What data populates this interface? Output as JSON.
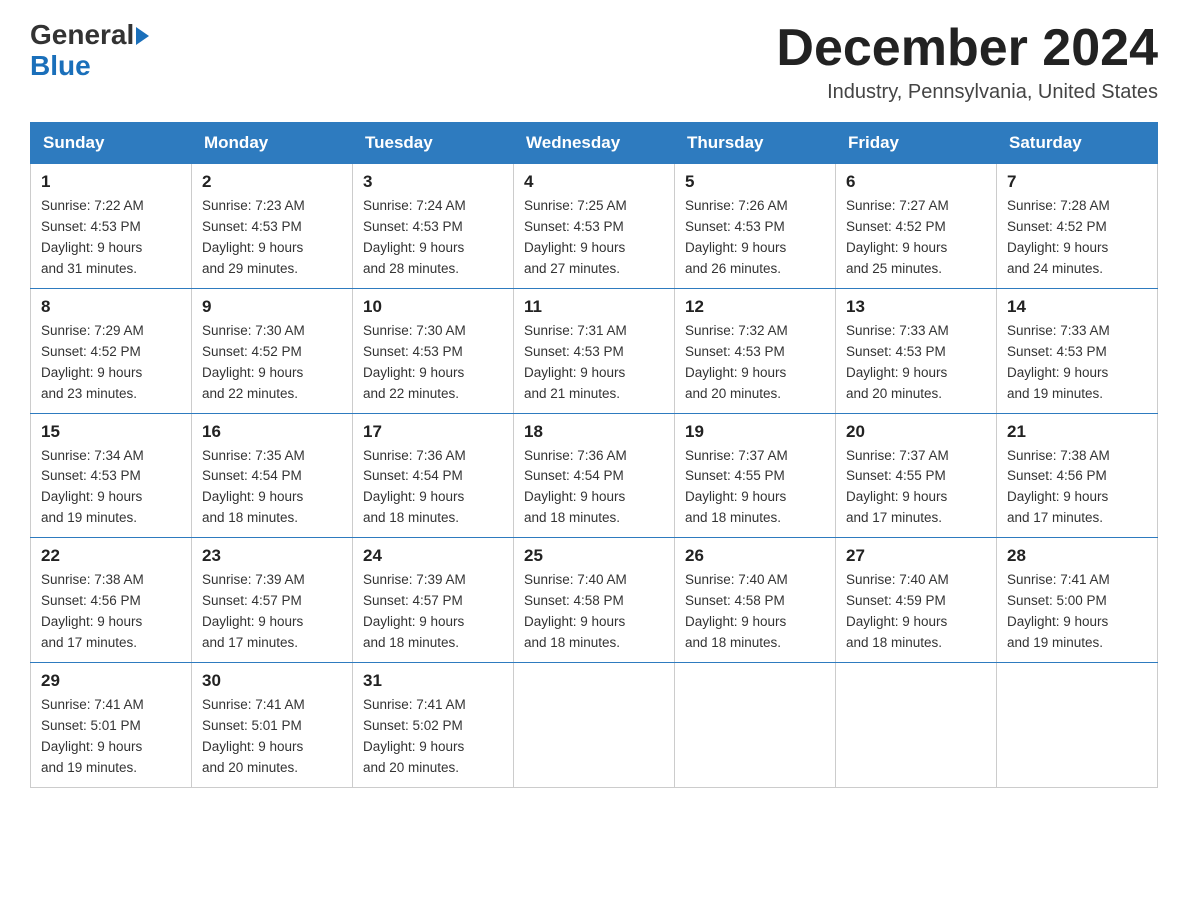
{
  "header": {
    "logo_general": "General",
    "logo_blue": "Blue",
    "title": "December 2024",
    "location": "Industry, Pennsylvania, United States"
  },
  "days_of_week": [
    "Sunday",
    "Monday",
    "Tuesday",
    "Wednesday",
    "Thursday",
    "Friday",
    "Saturday"
  ],
  "weeks": [
    [
      {
        "day": "1",
        "sunrise": "7:22 AM",
        "sunset": "4:53 PM",
        "daylight": "9 hours and 31 minutes."
      },
      {
        "day": "2",
        "sunrise": "7:23 AM",
        "sunset": "4:53 PM",
        "daylight": "9 hours and 29 minutes."
      },
      {
        "day": "3",
        "sunrise": "7:24 AM",
        "sunset": "4:53 PM",
        "daylight": "9 hours and 28 minutes."
      },
      {
        "day": "4",
        "sunrise": "7:25 AM",
        "sunset": "4:53 PM",
        "daylight": "9 hours and 27 minutes."
      },
      {
        "day": "5",
        "sunrise": "7:26 AM",
        "sunset": "4:53 PM",
        "daylight": "9 hours and 26 minutes."
      },
      {
        "day": "6",
        "sunrise": "7:27 AM",
        "sunset": "4:52 PM",
        "daylight": "9 hours and 25 minutes."
      },
      {
        "day": "7",
        "sunrise": "7:28 AM",
        "sunset": "4:52 PM",
        "daylight": "9 hours and 24 minutes."
      }
    ],
    [
      {
        "day": "8",
        "sunrise": "7:29 AM",
        "sunset": "4:52 PM",
        "daylight": "9 hours and 23 minutes."
      },
      {
        "day": "9",
        "sunrise": "7:30 AM",
        "sunset": "4:52 PM",
        "daylight": "9 hours and 22 minutes."
      },
      {
        "day": "10",
        "sunrise": "7:30 AM",
        "sunset": "4:53 PM",
        "daylight": "9 hours and 22 minutes."
      },
      {
        "day": "11",
        "sunrise": "7:31 AM",
        "sunset": "4:53 PM",
        "daylight": "9 hours and 21 minutes."
      },
      {
        "day": "12",
        "sunrise": "7:32 AM",
        "sunset": "4:53 PM",
        "daylight": "9 hours and 20 minutes."
      },
      {
        "day": "13",
        "sunrise": "7:33 AM",
        "sunset": "4:53 PM",
        "daylight": "9 hours and 20 minutes."
      },
      {
        "day": "14",
        "sunrise": "7:33 AM",
        "sunset": "4:53 PM",
        "daylight": "9 hours and 19 minutes."
      }
    ],
    [
      {
        "day": "15",
        "sunrise": "7:34 AM",
        "sunset": "4:53 PM",
        "daylight": "9 hours and 19 minutes."
      },
      {
        "day": "16",
        "sunrise": "7:35 AM",
        "sunset": "4:54 PM",
        "daylight": "9 hours and 18 minutes."
      },
      {
        "day": "17",
        "sunrise": "7:36 AM",
        "sunset": "4:54 PM",
        "daylight": "9 hours and 18 minutes."
      },
      {
        "day": "18",
        "sunrise": "7:36 AM",
        "sunset": "4:54 PM",
        "daylight": "9 hours and 18 minutes."
      },
      {
        "day": "19",
        "sunrise": "7:37 AM",
        "sunset": "4:55 PM",
        "daylight": "9 hours and 18 minutes."
      },
      {
        "day": "20",
        "sunrise": "7:37 AM",
        "sunset": "4:55 PM",
        "daylight": "9 hours and 17 minutes."
      },
      {
        "day": "21",
        "sunrise": "7:38 AM",
        "sunset": "4:56 PM",
        "daylight": "9 hours and 17 minutes."
      }
    ],
    [
      {
        "day": "22",
        "sunrise": "7:38 AM",
        "sunset": "4:56 PM",
        "daylight": "9 hours and 17 minutes."
      },
      {
        "day": "23",
        "sunrise": "7:39 AM",
        "sunset": "4:57 PM",
        "daylight": "9 hours and 17 minutes."
      },
      {
        "day": "24",
        "sunrise": "7:39 AM",
        "sunset": "4:57 PM",
        "daylight": "9 hours and 18 minutes."
      },
      {
        "day": "25",
        "sunrise": "7:40 AM",
        "sunset": "4:58 PM",
        "daylight": "9 hours and 18 minutes."
      },
      {
        "day": "26",
        "sunrise": "7:40 AM",
        "sunset": "4:58 PM",
        "daylight": "9 hours and 18 minutes."
      },
      {
        "day": "27",
        "sunrise": "7:40 AM",
        "sunset": "4:59 PM",
        "daylight": "9 hours and 18 minutes."
      },
      {
        "day": "28",
        "sunrise": "7:41 AM",
        "sunset": "5:00 PM",
        "daylight": "9 hours and 19 minutes."
      }
    ],
    [
      {
        "day": "29",
        "sunrise": "7:41 AM",
        "sunset": "5:01 PM",
        "daylight": "9 hours and 19 minutes."
      },
      {
        "day": "30",
        "sunrise": "7:41 AM",
        "sunset": "5:01 PM",
        "daylight": "9 hours and 20 minutes."
      },
      {
        "day": "31",
        "sunrise": "7:41 AM",
        "sunset": "5:02 PM",
        "daylight": "9 hours and 20 minutes."
      },
      null,
      null,
      null,
      null
    ]
  ],
  "labels": {
    "sunrise": "Sunrise:",
    "sunset": "Sunset:",
    "daylight": "Daylight:"
  }
}
